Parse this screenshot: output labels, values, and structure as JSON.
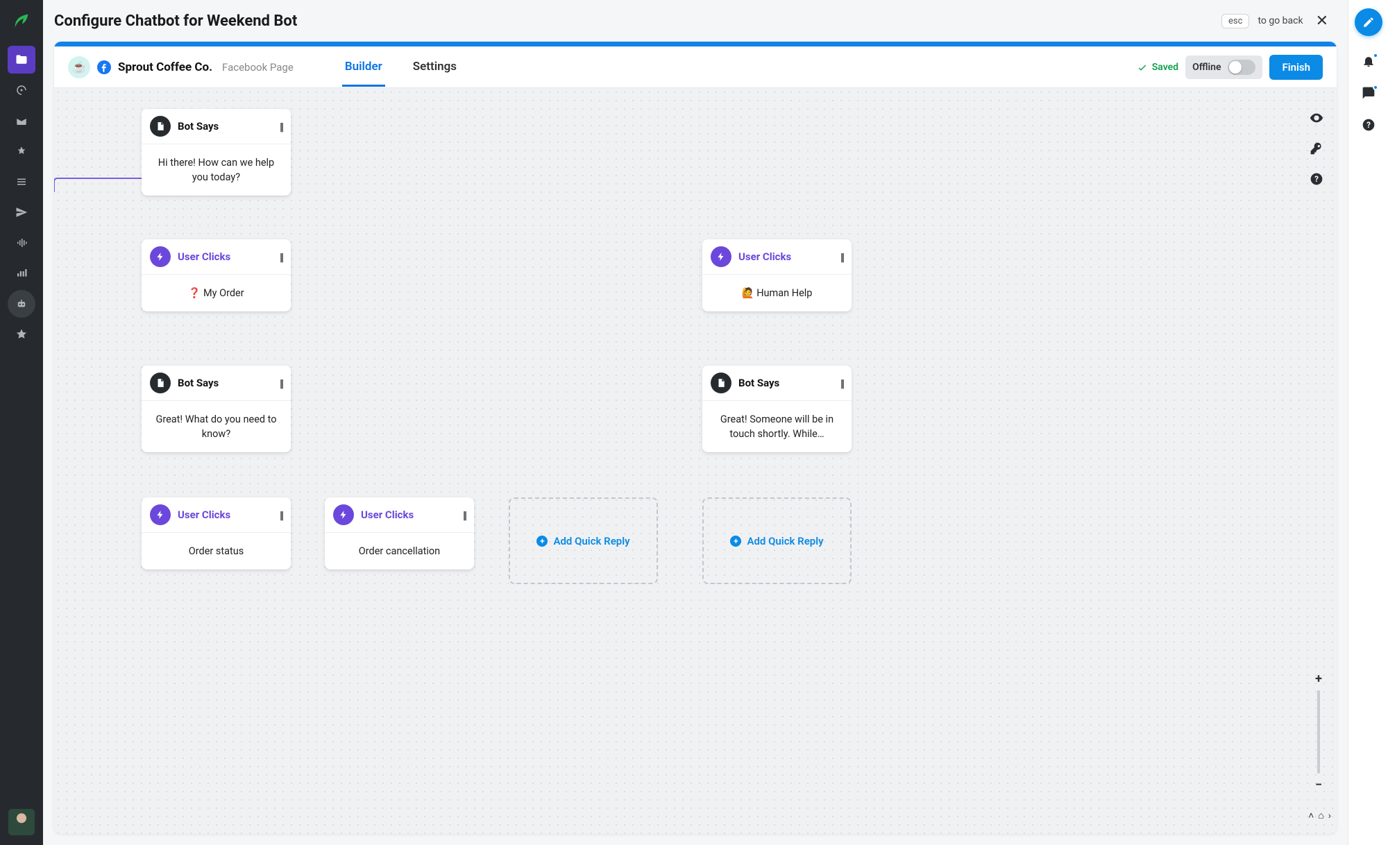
{
  "header": {
    "title": "Configure Chatbot for Weekend Bot",
    "esc_label": "esc",
    "goback_label": "to go back"
  },
  "account": {
    "company": "Sprout Coffee Co.",
    "subtype": "Facebook Page",
    "brand_emoji": "☕"
  },
  "tabs": {
    "builder": "Builder",
    "settings": "Settings"
  },
  "status": {
    "saved": "Saved",
    "offline": "Offline",
    "finish": "Finish"
  },
  "nodes": {
    "bot_says_label": "Bot Says",
    "user_clicks_label": "User Clicks",
    "add_quick_reply": "Add Quick Reply",
    "n1_body": "Hi there! How can we help you today?",
    "n2_body": "❓ My Order",
    "n3_body": "🙋 Human Help",
    "n4_body": "Great! What do you need to know?",
    "n5_body": "Great! Someone will be in touch shortly. While…",
    "n6_body": "Order status",
    "n7_body": "Order cancellation"
  },
  "colors": {
    "accent_blue": "#0b8ae6",
    "accent_purple": "#6b47dc",
    "success_green": "#0fa150"
  }
}
